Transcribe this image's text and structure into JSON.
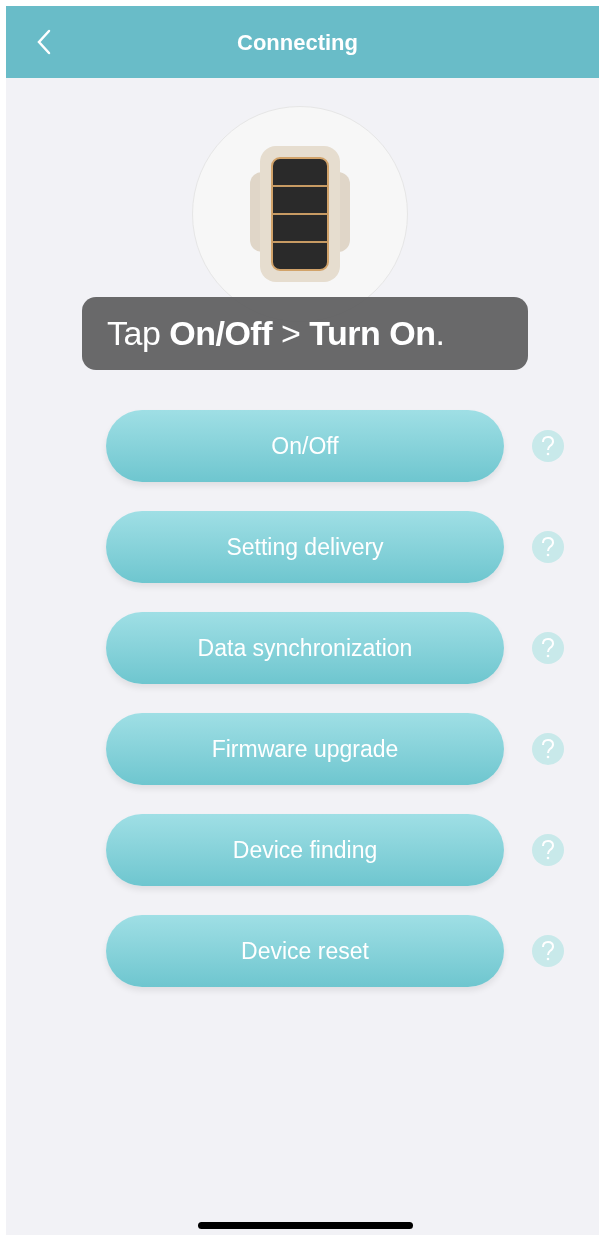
{
  "header": {
    "title": "Connecting"
  },
  "caption": "Tap **On/Off** > **Turn On**.",
  "actions": [
    {
      "label": "On/Off"
    },
    {
      "label": "Setting delivery"
    },
    {
      "label": "Data synchronization"
    },
    {
      "label": "Firmware upgrade"
    },
    {
      "label": "Device finding"
    },
    {
      "label": "Device reset"
    }
  ]
}
